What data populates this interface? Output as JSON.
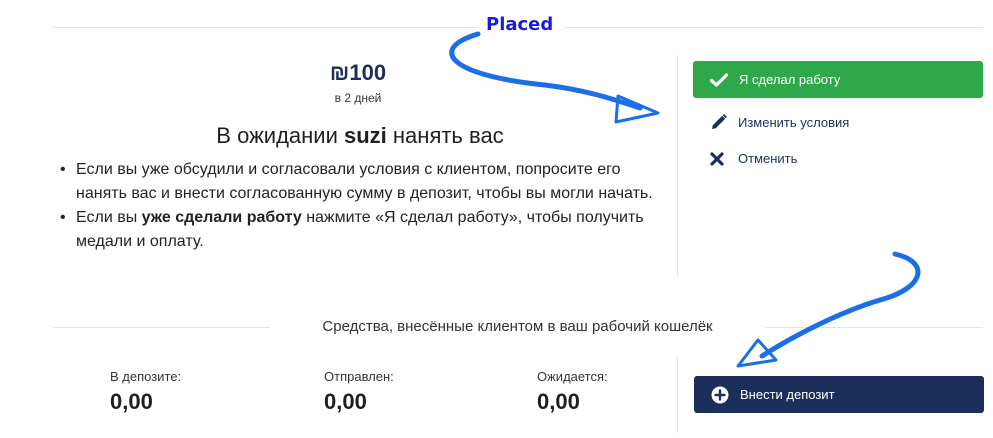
{
  "annotation": {
    "label": "Placed"
  },
  "offer": {
    "price": "₪100",
    "duration": "в 2 дней",
    "heading_prefix": "В ожидании ",
    "client_name": "suzi",
    "heading_suffix": " нанять вас",
    "bullet1": "Если вы уже обсудили и согласовали условия с клиентом, попросите его нанять вас и внести согласованную сумму в депозит, чтобы вы могли начать.",
    "bullet2_prefix": "Если вы ",
    "bullet2_bold": "уже сделали работу",
    "bullet2_suffix": " нажмите «Я сделал работу», чтобы получить медали и оплату."
  },
  "actions": {
    "done_label": "Я сделал работу",
    "edit_label": "Изменить условия",
    "cancel_label": "Отменить",
    "deposit_label": "Внести депозит"
  },
  "funds": {
    "title": "Средства, внесённые клиентом в ваш рабочий кошелёк",
    "deposited_label": "В депозите:",
    "deposited_value": "0,00",
    "sent_label": "Отправлен:",
    "sent_value": "0,00",
    "expected_label": "Ожидается:",
    "expected_value": "0,00"
  },
  "colors": {
    "primary": "#1b2f5a",
    "success": "#2ea84a",
    "annotation": "#1a6ee8",
    "annotation_label": "#1a1ae0"
  }
}
